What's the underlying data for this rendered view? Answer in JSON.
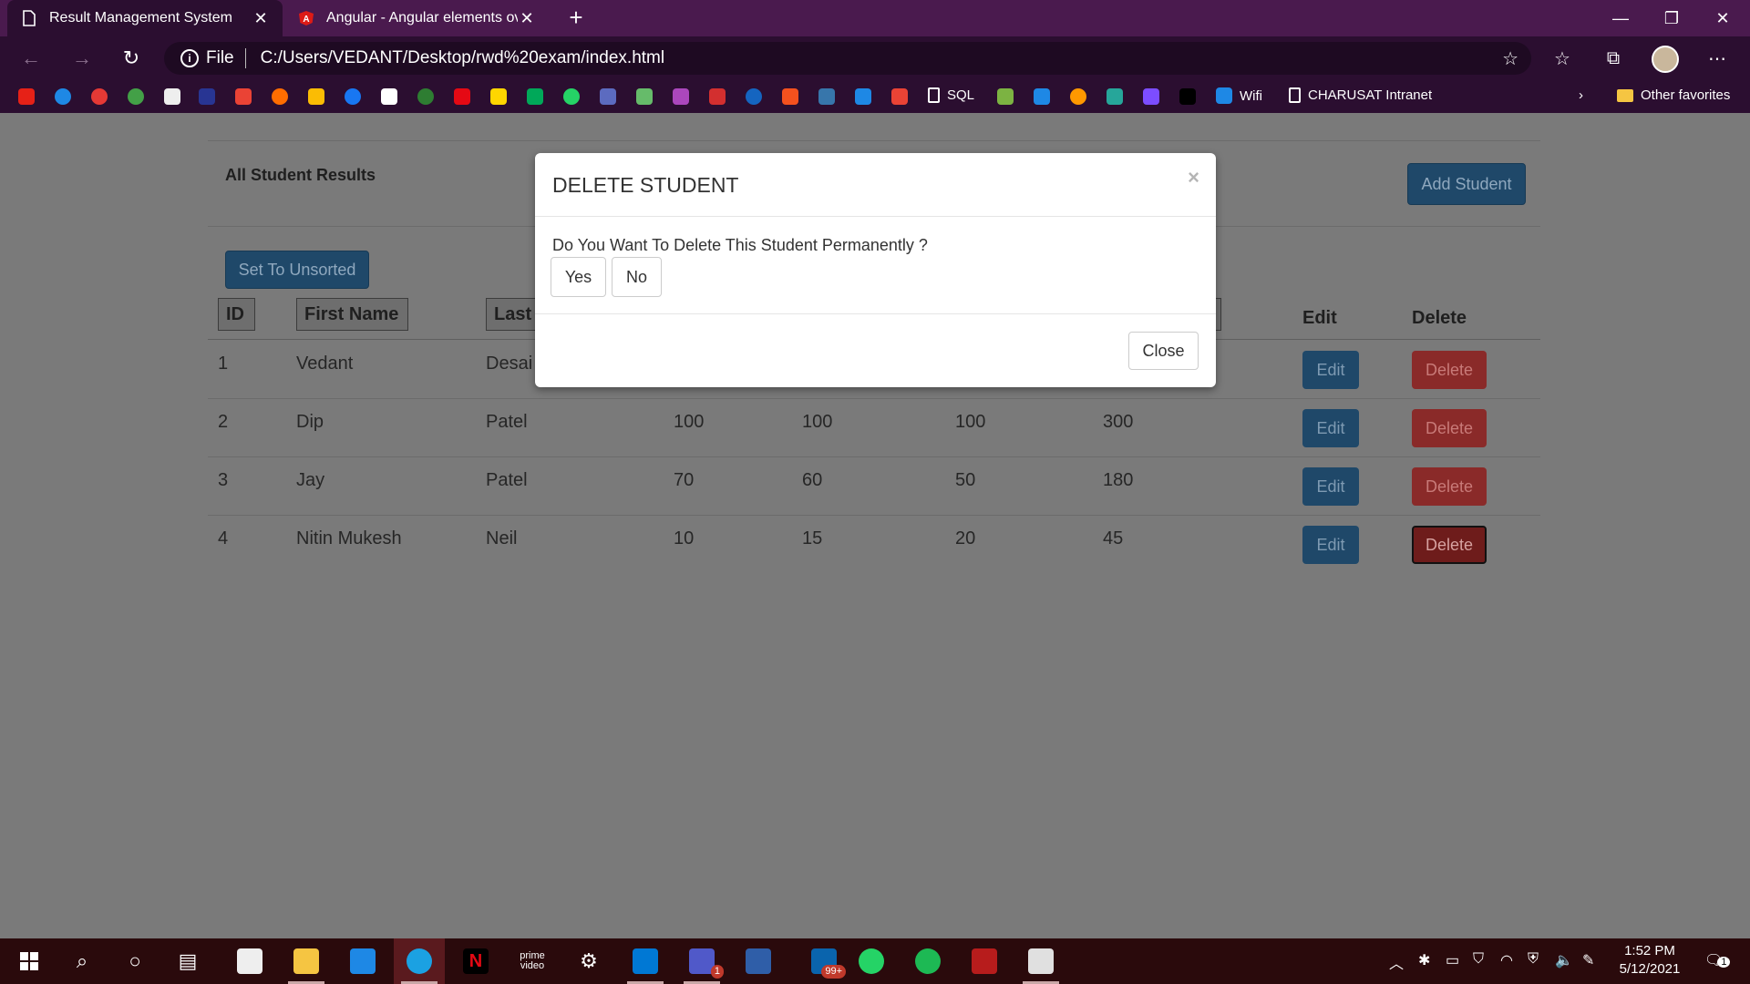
{
  "browser": {
    "tabs": [
      {
        "title": "Result Management System",
        "icon": "document-icon",
        "active": true
      },
      {
        "title": "Angular - Angular elements over",
        "icon": "angular-icon",
        "active": false
      }
    ],
    "address": {
      "scheme_label": "File",
      "url": "C:/Users/VEDANT/Desktop/rwd%20exam/index.html"
    },
    "favorites": {
      "items": [
        {
          "label": "SQL"
        },
        {
          "label": "Wifi"
        },
        {
          "label": "CHARUSAT Intranet"
        }
      ],
      "other_label": "Other favorites"
    }
  },
  "page": {
    "title": "All Student Results",
    "add_button": "Add Student",
    "sort_button": "Set To Unsorted",
    "columns": {
      "id": "ID",
      "first": "First Name",
      "last": "Last",
      "edit": "Edit",
      "delete": "Delete"
    },
    "rows": [
      {
        "id": "1",
        "first": "Vedant",
        "last": "Desai",
        "s1": "",
        "s2": "",
        "s3": "",
        "total": ""
      },
      {
        "id": "2",
        "first": "Dip",
        "last": "Patel",
        "s1": "100",
        "s2": "100",
        "s3": "100",
        "total": "300"
      },
      {
        "id": "3",
        "first": "Jay",
        "last": "Patel",
        "s1": "70",
        "s2": "60",
        "s3": "50",
        "total": "180"
      },
      {
        "id": "4",
        "first": "Nitin Mukesh",
        "last": "Neil",
        "s1": "10",
        "s2": "15",
        "s3": "20",
        "total": "45"
      }
    ],
    "edit_label": "Edit",
    "delete_label": "Delete"
  },
  "modal": {
    "title": "DELETE STUDENT",
    "close_x": "×",
    "question": "Do You Want To Delete This Student Permanently ?",
    "yes": "Yes",
    "no": "No",
    "close": "Close"
  },
  "taskbar": {
    "time": "1:52 PM",
    "date": "5/12/2021",
    "badges": {
      "teams": "1",
      "outlook": "99+",
      "notifications": "1"
    }
  }
}
